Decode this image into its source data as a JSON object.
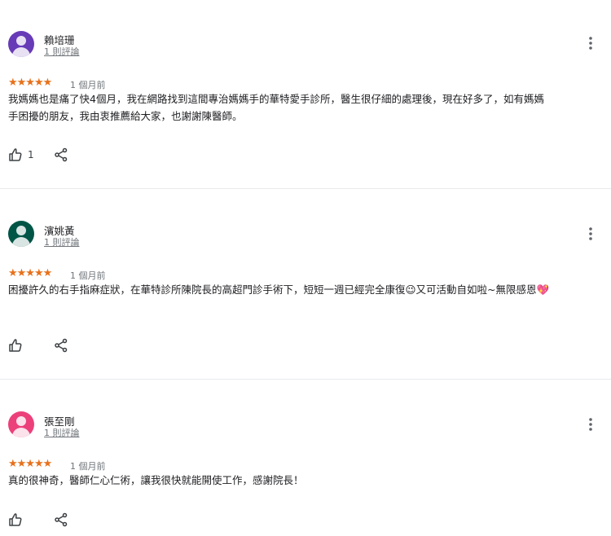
{
  "reviews": [
    {
      "name": "賴培珊",
      "review_count": "1 則評論",
      "avatar_color": "#673ab7",
      "rating": 5,
      "stars": "★★★★★",
      "age": "1 個月前",
      "text": "我媽媽也是痛了快4個月，我在網路找到這間專治媽媽手的華特愛手診所，醫生很仔細的處理後，現在好多了，如有媽媽手困擾的朋友，我由衷推薦給大家，也謝謝陳醫師。",
      "like_count": "1"
    },
    {
      "name": "濱姚黃",
      "review_count": "1 則評論",
      "avatar_color": "#005546",
      "rating": 5,
      "stars": "★★★★★",
      "age": "1 個月前",
      "text": "困擾許久的右手指麻症狀，在華特診所陳院長的高超門診手術下，短短一週已經完全康復😉又可活動自如啦~無限感恩💖",
      "like_count": ""
    },
    {
      "name": "張至剛",
      "review_count": "1 則評論",
      "avatar_color": "#ec407a",
      "rating": 5,
      "stars": "★★★★★",
      "age": "1 個月前",
      "text": "真的很神奇，醫師仁心仁術，讓我很快就能開使工作，感謝院長！",
      "like_count": ""
    }
  ],
  "icons": {
    "more": "more-vert-icon",
    "like": "thumb-up-icon",
    "share": "share-icon",
    "avatar": "person-icon"
  }
}
